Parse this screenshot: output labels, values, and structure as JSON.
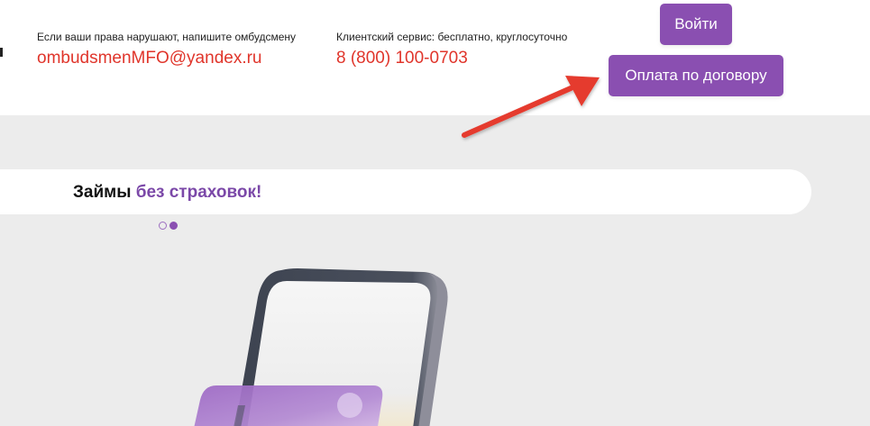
{
  "header": {
    "ombudsman": {
      "caption": "Если ваши права нарушают, напишите омбудсмену",
      "email": "ombudsmenMFO@yandex.ru"
    },
    "service": {
      "caption": "Клиентский сервис: бесплатно, круглосуточно",
      "phone": "8 (800) 100-0703"
    },
    "login_label": "Войти",
    "pay_label": "Оплата по договору"
  },
  "slider": {
    "title_main": "Займы ",
    "title_accent": "без страховок!",
    "active_dot": 2,
    "dot_count": 2
  },
  "colors": {
    "accent": "#8a4fb1",
    "link_red": "#e0352b",
    "arrow": "#e53a2f",
    "background": "#ececec"
  },
  "icons": {
    "annotation": "arrow-pointer-icon",
    "illustration": "phone-card-illustration"
  }
}
